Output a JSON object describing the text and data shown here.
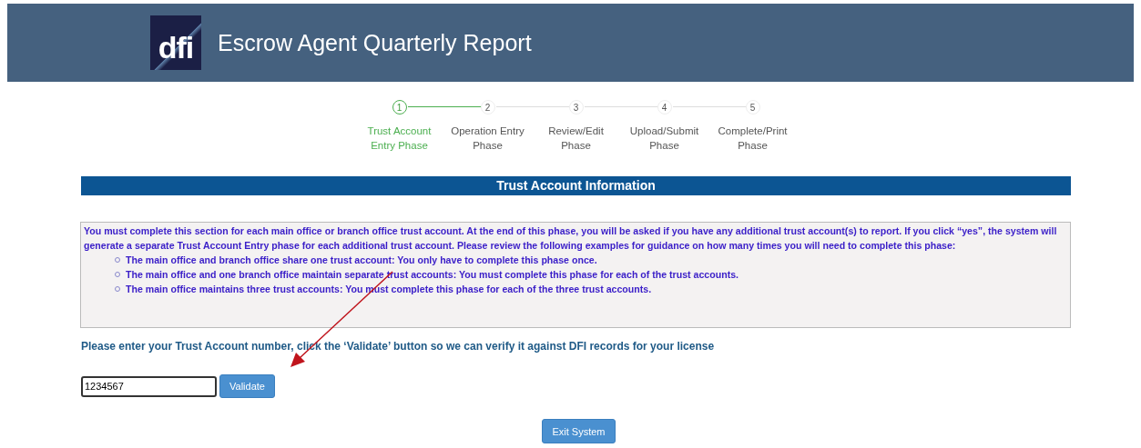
{
  "header": {
    "logo": "dfi",
    "title": "Escrow Agent Quarterly Report"
  },
  "steps": [
    {
      "number": "1",
      "label_lines": [
        "Trust Account",
        "Entry Phase"
      ],
      "selected": true
    },
    {
      "number": "2",
      "label_lines": [
        "Operation Entry",
        "Phase"
      ],
      "selected": false
    },
    {
      "number": "3",
      "label_lines": [
        "Review/Edit",
        "Phase"
      ],
      "selected": false
    },
    {
      "number": "4",
      "label_lines": [
        "Upload/Submit",
        "Phase"
      ],
      "selected": false
    },
    {
      "number": "5",
      "label_lines": [
        "Complete/Print",
        "Phase"
      ],
      "selected": false
    }
  ],
  "section_title": "Trust Account Information",
  "info": {
    "paragraph": "You must complete this section for each main office or branch office trust account. At the end of this phase, you will be asked if you have any additional trust account(s) to report. If you click “yes”, the system will generate a separate Trust Account Entry phase for each additional trust account. Please review the following examples for guidance on how many times you will need to complete this phase:",
    "bullets": [
      "The main office and branch office share one trust account: You only have to complete this phase once.",
      "The main office and one branch office maintain separate trust accounts: You must complete this phase for each of the trust accounts.",
      "The main office maintains three trust accounts: You must complete this phase for each of the three trust accounts."
    ]
  },
  "prompt": "Please enter your Trust Account number, click the ‘Validate’ button so we can verify it against DFI records for your license",
  "account_field": {
    "value": "1234567"
  },
  "validate_button": "Validate",
  "exit_button": "Exit System"
}
